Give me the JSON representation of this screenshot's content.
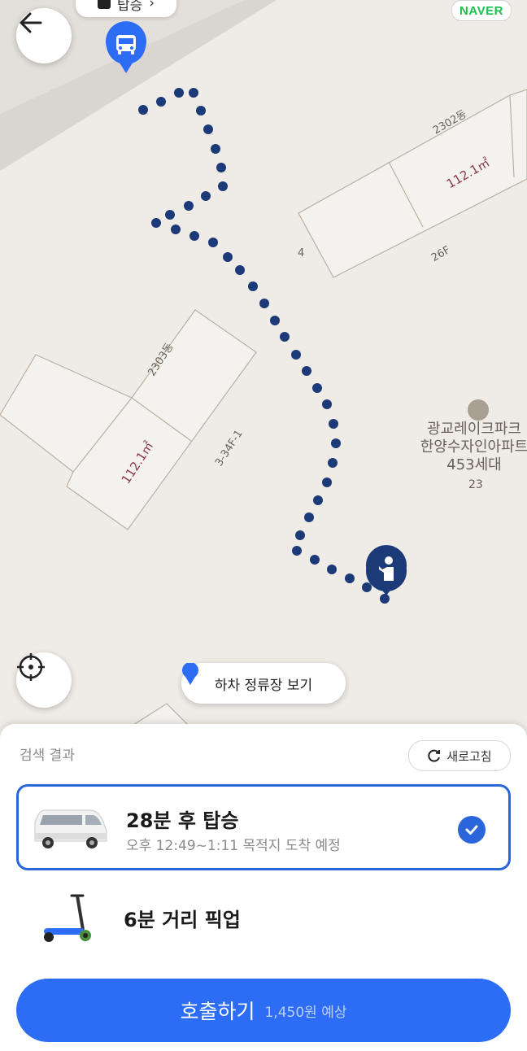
{
  "map": {
    "top_chip_label": "탑승",
    "naver_logo": "NAVER",
    "buildings": [
      {
        "name": "2302동",
        "area": "112.1㎡",
        "floors": "26F",
        "number": "4"
      },
      {
        "name": "2303동",
        "area": "112.1㎡",
        "floors": "3-34F-1"
      }
    ],
    "poi": {
      "name_lines": [
        "광교레이크파크",
        "한양수자인아파트",
        "453세대"
      ],
      "number": "23"
    },
    "dropoff_button_label": "하차 정류장 보기",
    "route_color": "#1c3a78",
    "accent_color": "#2d6cf4"
  },
  "sheet": {
    "title": "검색 결과",
    "refresh_label": "새로고침",
    "options": [
      {
        "title": "28분 후 탑승",
        "subtitle": "오후 12:49~1:11 목적지 도착 예정",
        "icon": "van-icon",
        "selected": true
      },
      {
        "title": "6분 거리 픽업",
        "subtitle": "",
        "icon": "kickscooter-icon",
        "selected": false
      }
    ],
    "cta": {
      "label": "호출하기",
      "price": "1,450원 예상"
    }
  }
}
